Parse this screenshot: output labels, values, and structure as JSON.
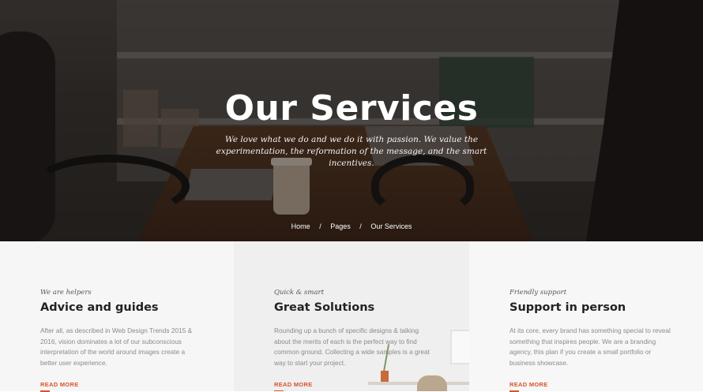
{
  "hero": {
    "title": "Our Services",
    "subtitle": "We love what we do and we do it with passion. We value the experimentation, the reformation of the message, and the smart incentives."
  },
  "breadcrumb": {
    "items": [
      "Home",
      "Pages",
      "Our Services"
    ],
    "separator": "/"
  },
  "services": [
    {
      "tag": "We are helpers",
      "title": "Advice and guides",
      "text": "After all, as described in Web Design Trends 2015 & 2016, vision dominates a lot of our subconscious interpretation of the world around images create a better user experience.",
      "link": "READ MORE"
    },
    {
      "tag": "Quick & smart",
      "title": "Great Solutions",
      "text": "Rounding up a bunch of specific designs & talking about the merits of each is the perfect way to find common ground. Collecting a wide samples is a great way to start your project.",
      "link": "READ MORE"
    },
    {
      "tag": "Friendly support",
      "title": "Support in person",
      "text": "At its core, every brand has something special to reveal something that inspires people. We are a branding agency, this plan if you create a small portfolio or business showcase.",
      "link": "READ MORE"
    }
  ],
  "colors": {
    "accent": "#d9532c",
    "heading": "#222222",
    "body_text": "#8a8a8a"
  }
}
